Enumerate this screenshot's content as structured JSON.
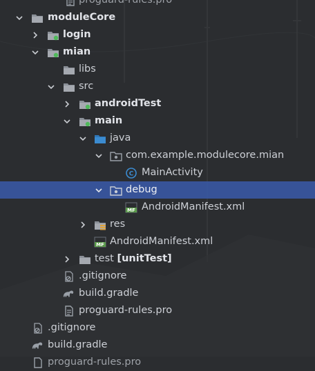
{
  "tree": {
    "rows": [
      {
        "label": "proguard-rules.pro"
      },
      {
        "label": "moduleCore"
      },
      {
        "label": "login"
      },
      {
        "label": "mian"
      },
      {
        "label": "libs"
      },
      {
        "label": "src"
      },
      {
        "label": "androidTest"
      },
      {
        "label": "main"
      },
      {
        "label": "java"
      },
      {
        "label": "com.example.modulecore.mian"
      },
      {
        "label": "MainActivity"
      },
      {
        "label": "debug"
      },
      {
        "label": "AndroidManifest.xml"
      },
      {
        "label": "res"
      },
      {
        "label": "AndroidManifest.xml"
      },
      {
        "label": "test",
        "suffix": "[unitTest]"
      },
      {
        "label": ".gitignore"
      },
      {
        "label": "build.gradle"
      },
      {
        "label": "proguard-rules.pro"
      },
      {
        "label": ".gitignore"
      },
      {
        "label": "build.gradle"
      },
      {
        "label": "proguard-rules.pro"
      }
    ]
  },
  "icons": {
    "folder": "folder-icon",
    "module": "module-folder-icon",
    "source_root": "source-folder-icon",
    "package": "package-icon",
    "class": "class-icon",
    "manifest": "manifest-icon",
    "resources": "resources-folder-icon",
    "gitignore": "gitignore-icon",
    "gradle": "gradle-icon",
    "file": "file-icon"
  },
  "colors": {
    "background": "#2b2d30",
    "selection": "#3a5baa",
    "text": "#cdd0d6",
    "folder": "#8a8f97",
    "source_folder": "#3b8bd0",
    "module_dot": "#4fba5a",
    "class": "#3b8bd0",
    "manifest": "#5a9a4a"
  }
}
